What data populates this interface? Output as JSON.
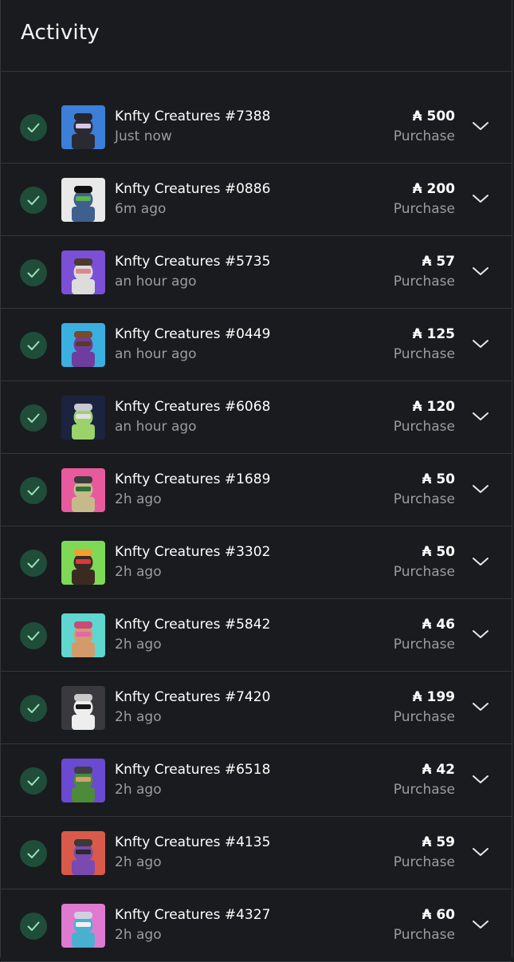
{
  "header": {
    "title": "Activity"
  },
  "currency_symbol": "₳",
  "activities": [
    {
      "name": "Knfty Creatures #7388",
      "time": "Just now",
      "price": "₳ 500",
      "type": "Purchase",
      "thumb": {
        "bg": "#3b7fd9",
        "body": "#2b2a33",
        "accent": "#d8c7e8",
        "hat": "#26262c"
      }
    },
    {
      "name": "Knfty Creatures #0886",
      "time": "6m ago",
      "price": "₳ 200",
      "type": "Purchase",
      "thumb": {
        "bg": "#e9e9e9",
        "body": "#3f5f8f",
        "accent": "#5fb24d",
        "hat": "#111111"
      }
    },
    {
      "name": "Knfty Creatures #5735",
      "time": "an hour ago",
      "price": "₳ 57",
      "type": "Purchase",
      "thumb": {
        "bg": "#7b4fd6",
        "body": "#dcdcdc",
        "accent": "#d88a8a",
        "hat": "#4a3b2d"
      }
    },
    {
      "name": "Knfty Creatures #0449",
      "time": "an hour ago",
      "price": "₳ 125",
      "type": "Purchase",
      "thumb": {
        "bg": "#3ab0e0",
        "body": "#6f3da0",
        "accent": "#5a3a22",
        "hat": "#7b4a2a"
      }
    },
    {
      "name": "Knfty Creatures #6068",
      "time": "an hour ago",
      "price": "₳ 120",
      "type": "Purchase",
      "thumb": {
        "bg": "#1c2340",
        "body": "#9bd36a",
        "accent": "#e0e0e0",
        "hat": "#c8c8d0"
      }
    },
    {
      "name": "Knfty Creatures #1689",
      "time": "2h ago",
      "price": "₳ 50",
      "type": "Purchase",
      "thumb": {
        "bg": "#e85a9e",
        "body": "#c7b98a",
        "accent": "#2e6f3a",
        "hat": "#3a3a3a"
      }
    },
    {
      "name": "Knfty Creatures #3302",
      "time": "2h ago",
      "price": "₳ 50",
      "type": "Purchase",
      "thumb": {
        "bg": "#7ed957",
        "body": "#3b2a22",
        "accent": "#d93b3b",
        "hat": "#f0a030"
      }
    },
    {
      "name": "Knfty Creatures #5842",
      "time": "2h ago",
      "price": "₳ 46",
      "type": "Purchase",
      "thumb": {
        "bg": "#5fd6d0",
        "body": "#d49b6a",
        "accent": "#e06aa8",
        "hat": "#c84b7a"
      }
    },
    {
      "name": "Knfty Creatures #7420",
      "time": "2h ago",
      "price": "₳ 199",
      "type": "Purchase",
      "thumb": {
        "bg": "#3a3a3e",
        "body": "#eeeeee",
        "accent": "#1a1a1a",
        "hat": "#c9c9c9"
      }
    },
    {
      "name": "Knfty Creatures #6518",
      "time": "2h ago",
      "price": "₳ 42",
      "type": "Purchase",
      "thumb": {
        "bg": "#6a4ad0",
        "body": "#4d8a3a",
        "accent": "#d0a070",
        "hat": "#3e3e44"
      }
    },
    {
      "name": "Knfty Creatures #4135",
      "time": "2h ago",
      "price": "₳ 59",
      "type": "Purchase",
      "thumb": {
        "bg": "#d95a4a",
        "body": "#7a4ab0",
        "accent": "#2a2a2a",
        "hat": "#3a3a3a"
      }
    },
    {
      "name": "Knfty Creatures #4327",
      "time": "2h ago",
      "price": "₳ 60",
      "type": "Purchase",
      "thumb": {
        "bg": "#e07ad0",
        "body": "#4ab0d0",
        "accent": "#f0f0f0",
        "hat": "#d0d0e0"
      }
    }
  ]
}
